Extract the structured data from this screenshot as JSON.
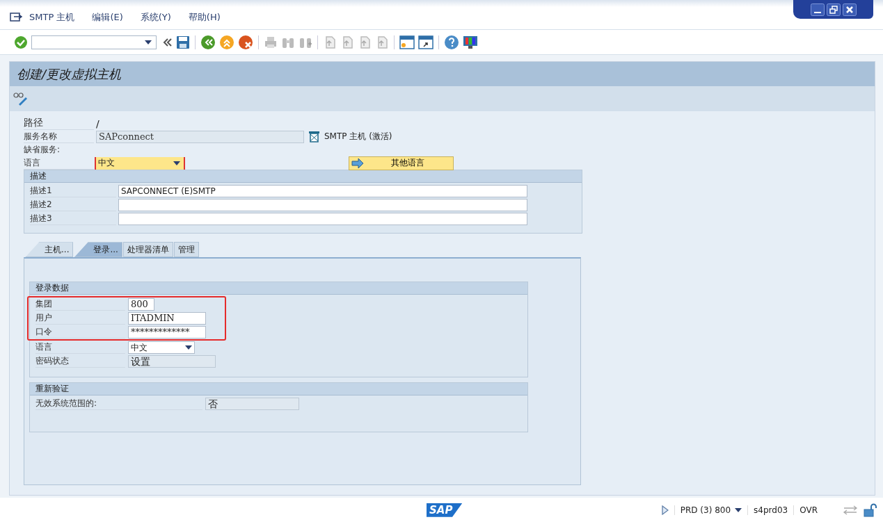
{
  "menu": [
    "SMTP 主机",
    "编辑(E)",
    "系统(Y)",
    "帮助(H)"
  ],
  "title": "创建/更改虚拟主机",
  "header_fields": [
    {
      "kind": "text",
      "label": "路径",
      "value": "/"
    },
    {
      "kind": "readonly",
      "label": "服务名称",
      "value": "SAPconnect",
      "note": "SMTP 主机 (激活)"
    },
    {
      "kind": "label",
      "label": "缺省服务:"
    },
    {
      "kind": "dropdown",
      "label": "语言",
      "value": "中文",
      "required": true,
      "button": "其他语言"
    }
  ],
  "description": {
    "title": "描述",
    "rows": [
      {
        "label": "描述1",
        "value": "SAPCONNECT (E)SMTP"
      },
      {
        "label": "描述2",
        "value": ""
      },
      {
        "label": "描述3",
        "value": ""
      }
    ]
  },
  "tabs": [
    {
      "label": "主机...",
      "selected": false
    },
    {
      "label": "登录...",
      "selected": true
    },
    {
      "label": "处理器清单",
      "selected": false
    },
    {
      "label": "管理",
      "selected": false
    }
  ],
  "login_data": {
    "title": "登录数据",
    "rows": [
      {
        "kind": "input",
        "label": "集团",
        "value": "800",
        "highlighted": true
      },
      {
        "kind": "input",
        "label": "用户",
        "value": "ITADMIN",
        "highlighted": true
      },
      {
        "kind": "input",
        "label": "口令",
        "value": "*************",
        "highlighted": true
      },
      {
        "kind": "dropdown",
        "label": "语言",
        "value": "中文",
        "highlighted": false
      },
      {
        "kind": "readonly",
        "label": "密码状态",
        "value": "设置",
        "highlighted": false
      }
    ]
  },
  "reauth": {
    "title": "重新验证",
    "rows": [
      {
        "label": "无效系统范围的:",
        "value": "否"
      }
    ]
  },
  "status_bar": {
    "logo": "SAP",
    "system": "PRD (3) 800",
    "server": "s4prd03",
    "mode": "OVR"
  }
}
